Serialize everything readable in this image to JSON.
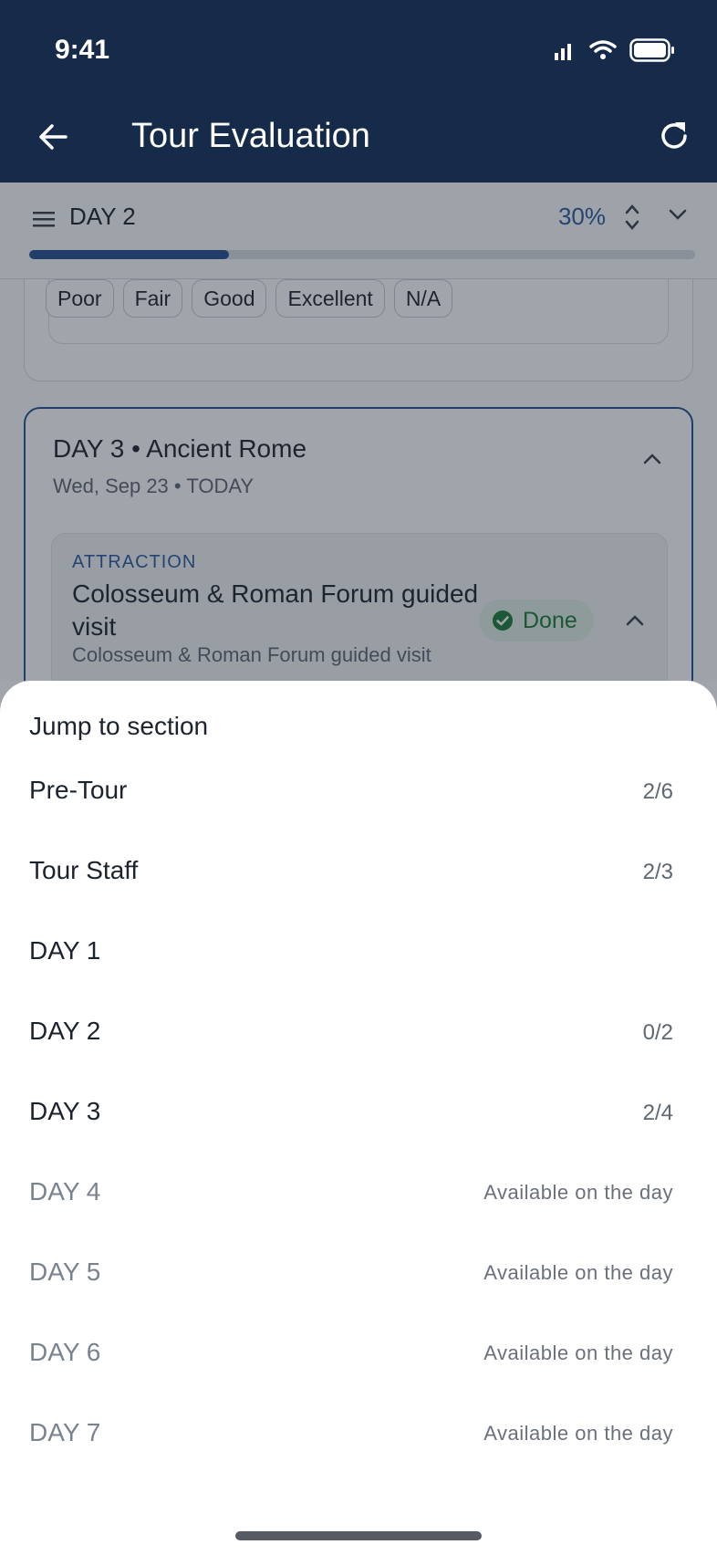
{
  "status_bar": {
    "time": "9:41"
  },
  "app_bar": {
    "title": "Tour Evaluation"
  },
  "progress": {
    "day_label": "DAY 2",
    "percent_label": "30%",
    "fraction": 0.3
  },
  "previous_card": {
    "rating_options": [
      "Poor",
      "Fair",
      "Good",
      "Excellent",
      "N/A"
    ]
  },
  "day_card": {
    "title": "DAY 3 • Ancient Rome",
    "subtitle": "Wed, Sep 23 • TODAY",
    "attraction": {
      "type_label": "ATTRACTION",
      "title": "Colosseum & Roman Forum guided visit",
      "description": "Colosseum & Roman Forum guided visit",
      "status_label": "Done"
    }
  },
  "sheet": {
    "title": "Jump to section",
    "sections": [
      {
        "name": "Pre-Tour",
        "count": "2/6",
        "locked": false
      },
      {
        "name": "Tour Staff",
        "count": "2/3",
        "locked": false
      },
      {
        "name": "DAY 1",
        "count": "",
        "locked": false
      },
      {
        "name": "DAY 2",
        "count": "0/2",
        "locked": false
      },
      {
        "name": "DAY 3",
        "count": "2/4",
        "locked": false
      },
      {
        "name": "DAY 4",
        "count": "Available on the day",
        "locked": true
      },
      {
        "name": "DAY 5",
        "count": "Available on the day",
        "locked": true
      },
      {
        "name": "DAY 6",
        "count": "Available on the day",
        "locked": true
      },
      {
        "name": "DAY 7",
        "count": "Available on the day",
        "locked": true
      }
    ]
  },
  "colors": {
    "primary": "#162a49",
    "accent": "#244f8f",
    "success": "#1a7a3c"
  }
}
